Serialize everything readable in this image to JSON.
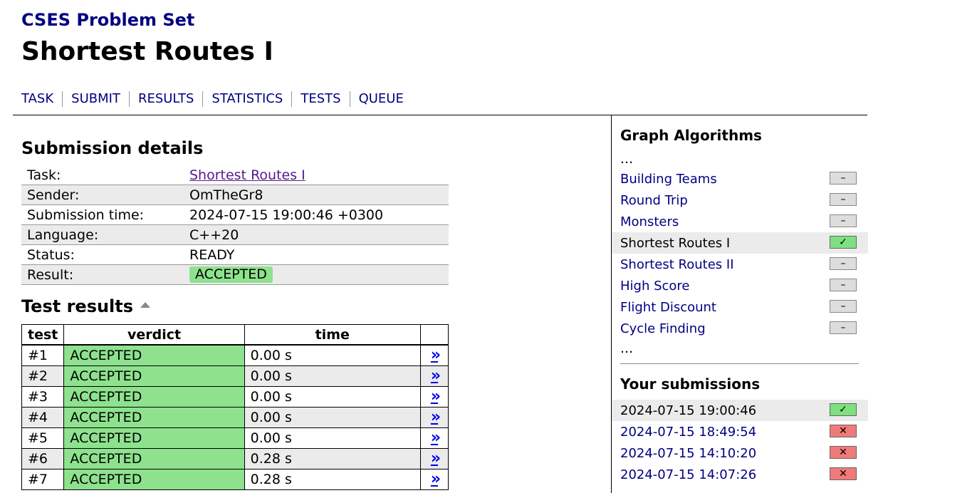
{
  "header": {
    "site_title": "CSES Problem Set",
    "page_title": "Shortest Routes I",
    "nav": [
      "TASK",
      "SUBMIT",
      "RESULTS",
      "STATISTICS",
      "TESTS",
      "QUEUE"
    ]
  },
  "submission": {
    "heading": "Submission details",
    "rows": [
      {
        "label": "Task:",
        "value": "Shortest Routes I"
      },
      {
        "label": "Sender:",
        "value": "OmTheGr8"
      },
      {
        "label": "Submission time:",
        "value": "2024-07-15 19:00:46 +0300"
      },
      {
        "label": "Language:",
        "value": "C++20"
      },
      {
        "label": "Status:",
        "value": "READY"
      },
      {
        "label": "Result:",
        "value": "ACCEPTED"
      }
    ]
  },
  "tests": {
    "heading": "Test results",
    "columns": [
      "test",
      "verdict",
      "time",
      ""
    ],
    "rows": [
      {
        "test": "#1",
        "verdict": "ACCEPTED",
        "time": "0.00 s"
      },
      {
        "test": "#2",
        "verdict": "ACCEPTED",
        "time": "0.00 s"
      },
      {
        "test": "#3",
        "verdict": "ACCEPTED",
        "time": "0.00 s"
      },
      {
        "test": "#4",
        "verdict": "ACCEPTED",
        "time": "0.00 s"
      },
      {
        "test": "#5",
        "verdict": "ACCEPTED",
        "time": "0.00 s"
      },
      {
        "test": "#6",
        "verdict": "ACCEPTED",
        "time": "0.28 s"
      },
      {
        "test": "#7",
        "verdict": "ACCEPTED",
        "time": "0.28 s"
      }
    ],
    "detail_link": "»"
  },
  "sidebar": {
    "heading": "Graph Algorithms",
    "ellipsis": "...",
    "problems": [
      {
        "name": "Building Teams",
        "status": "none",
        "mark": "–"
      },
      {
        "name": "Round Trip",
        "status": "none",
        "mark": "–"
      },
      {
        "name": "Monsters",
        "status": "none",
        "mark": "–"
      },
      {
        "name": "Shortest Routes I",
        "status": "accepted",
        "mark": "✓",
        "current": true
      },
      {
        "name": "Shortest Routes II",
        "status": "none",
        "mark": "–"
      },
      {
        "name": "High Score",
        "status": "none",
        "mark": "–"
      },
      {
        "name": "Flight Discount",
        "status": "none",
        "mark": "–"
      },
      {
        "name": "Cycle Finding",
        "status": "none",
        "mark": "–"
      }
    ],
    "submissions_heading": "Your submissions",
    "submissions": [
      {
        "time": "2024-07-15 19:00:46",
        "status": "accepted",
        "mark": "✓",
        "current": true
      },
      {
        "time": "2024-07-15 18:49:54",
        "status": "rejected",
        "mark": "✕"
      },
      {
        "time": "2024-07-15 14:10:20",
        "status": "rejected",
        "mark": "✕"
      },
      {
        "time": "2024-07-15 14:07:26",
        "status": "rejected",
        "mark": "✕"
      }
    ]
  },
  "colors": {
    "link": "#000080",
    "accepted": "#8ee28e",
    "rejected": "#f07a7a",
    "row_alt": "#ebebeb"
  }
}
